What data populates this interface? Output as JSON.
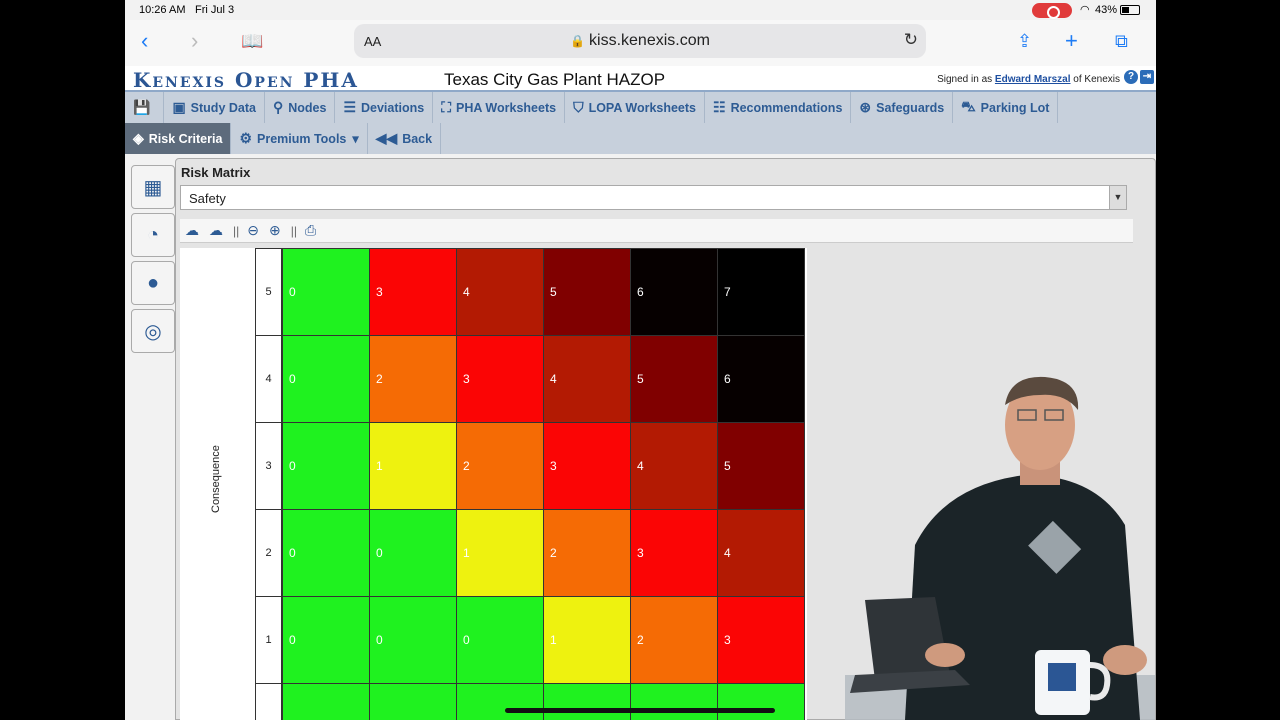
{
  "status": {
    "time": "10:26 AM",
    "date": "Fri Jul 3",
    "battery": "43%"
  },
  "browser": {
    "aa": "AA",
    "url": "kiss.kenexis.com"
  },
  "app": {
    "brand": "Kenexis Open PHA",
    "study_title": "Texas City Gas Plant HAZOP",
    "signed_prefix": "Signed in as",
    "user": "Edward Marszal",
    "signed_suffix": "of Kenexis"
  },
  "menu": {
    "row1": [
      {
        "label": "Study Data",
        "icon": "person-card-icon",
        "glyph": "▣"
      },
      {
        "label": "Nodes",
        "icon": "node-icon",
        "glyph": "⚲"
      },
      {
        "label": "Deviations",
        "icon": "database-icon",
        "glyph": "☰"
      },
      {
        "label": "PHA Worksheets",
        "icon": "worksheet-icon",
        "glyph": "⛶"
      },
      {
        "label": "LOPA Worksheets",
        "icon": "shield-icon",
        "glyph": "⛉"
      },
      {
        "label": "Recommendations",
        "icon": "list-icon",
        "glyph": "☷"
      },
      {
        "label": "Safeguards",
        "icon": "lifebuoy-icon",
        "glyph": "⊛"
      },
      {
        "label": "Parking Lot",
        "icon": "car-icon",
        "glyph": "⛍"
      }
    ],
    "row2": [
      {
        "label": "Risk Criteria",
        "icon": "cube-icon",
        "glyph": "◈",
        "active": true
      },
      {
        "label": "Premium Tools",
        "icon": "gears-icon",
        "glyph": "⚙",
        "caret": "▾"
      },
      {
        "label": "Back",
        "icon": "back-icon",
        "glyph": "◀◀"
      }
    ]
  },
  "sidetabs": [
    "boxes-icon",
    "gauge-icon",
    "bomb-icon",
    "target-icon"
  ],
  "panel": {
    "title": "Risk Matrix",
    "selected": "Safety",
    "toolbar": [
      "upload-icon",
      "download-icon",
      "zoom-out-icon",
      "zoom-in-icon",
      "print-icon"
    ]
  },
  "matrix": {
    "axis_label": "Consequence",
    "rows": [
      {
        "label": "5",
        "values": [
          "0",
          "3",
          "4",
          "5",
          "6",
          "7"
        ]
      },
      {
        "label": "4",
        "values": [
          "0",
          "2",
          "3",
          "4",
          "5",
          "6"
        ]
      },
      {
        "label": "3",
        "values": [
          "0",
          "1",
          "2",
          "3",
          "4",
          "5"
        ]
      },
      {
        "label": "2",
        "values": [
          "0",
          "0",
          "1",
          "2",
          "3",
          "4"
        ]
      },
      {
        "label": "1",
        "values": [
          "0",
          "0",
          "0",
          "1",
          "2",
          "3"
        ]
      }
    ],
    "colors": {
      "0": "#1ff21f",
      "1": "#eef20f",
      "2": "#f56b05",
      "3": "#fb0505",
      "4": "#b31a03",
      "5": "#800000",
      "6": "#060000",
      "7": "#000000"
    }
  }
}
